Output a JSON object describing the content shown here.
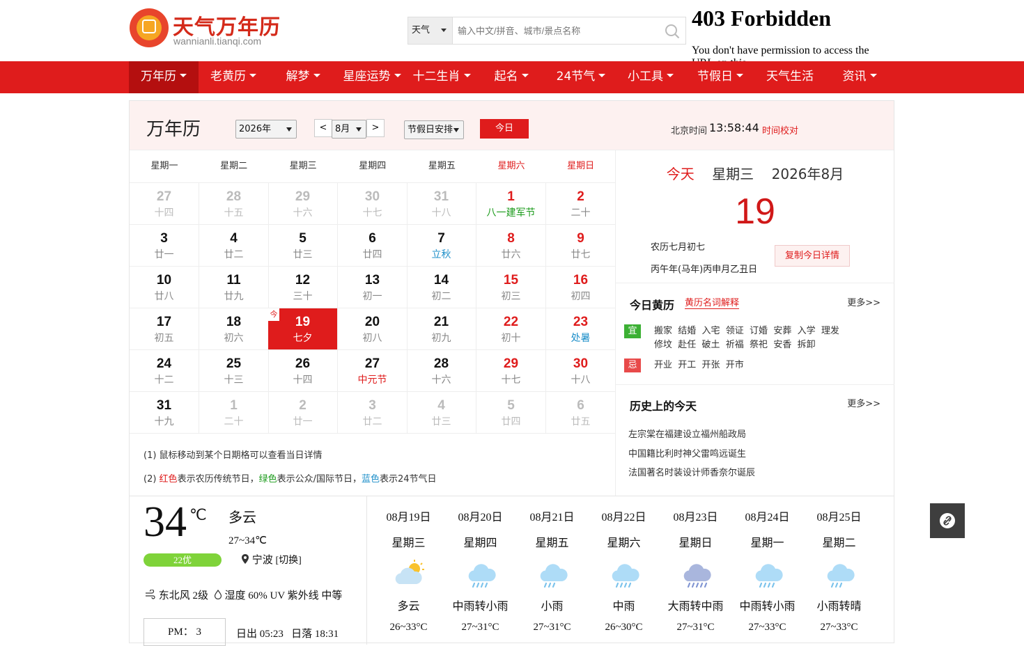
{
  "header": {
    "logo_title": "天气万年历",
    "logo_sub": "wannianli.tianqi.com",
    "search_type": "天气",
    "search_placeholder": "输入中文/拼音、城市/景点名称",
    "error_title": "403 Forbidden",
    "error_text": "You don't have permission to access the URL on this"
  },
  "nav": [
    {
      "label": "万年历",
      "caret": true
    },
    {
      "label": "老黄历",
      "caret": true
    },
    {
      "label": "解梦",
      "caret": true
    },
    {
      "label": "星座运势",
      "caret": true
    },
    {
      "label": "十二生肖",
      "caret": true
    },
    {
      "label": "起名",
      "caret": true
    },
    {
      "label": "24节气",
      "caret": true
    },
    {
      "label": "小工具",
      "caret": true
    },
    {
      "label": "节假日",
      "caret": true
    },
    {
      "label": "天气生活",
      "caret": false
    },
    {
      "label": "资讯",
      "caret": true
    }
  ],
  "calendar": {
    "title": "万年历",
    "year": "2026年",
    "prev": "<",
    "month": "8月",
    "next": ">",
    "holiday_select": "节假日安排",
    "today_btn": "今日",
    "beijing_label": "北京时间",
    "beijing_time": "13:58:44",
    "time_sync": "时间校对",
    "weekdays": [
      "星期一",
      "星期二",
      "星期三",
      "星期四",
      "星期五",
      "星期六",
      "星期日"
    ],
    "today_mark": "今",
    "weeks": [
      [
        {
          "d": "27",
          "l": "十四",
          "t": "other"
        },
        {
          "d": "28",
          "l": "十五",
          "t": "other"
        },
        {
          "d": "29",
          "l": "十六",
          "t": "other"
        },
        {
          "d": "30",
          "l": "十七",
          "t": "other"
        },
        {
          "d": "31",
          "l": "十八",
          "t": "other"
        },
        {
          "d": "1",
          "l": "八一建军节",
          "t": "red",
          "lc": "green"
        },
        {
          "d": "2",
          "l": "二十",
          "t": "red"
        }
      ],
      [
        {
          "d": "3",
          "l": "廿一"
        },
        {
          "d": "4",
          "l": "廿二"
        },
        {
          "d": "5",
          "l": "廿三"
        },
        {
          "d": "6",
          "l": "廿四"
        },
        {
          "d": "7",
          "l": "立秋",
          "lc": "blue"
        },
        {
          "d": "8",
          "l": "廿六",
          "t": "red"
        },
        {
          "d": "9",
          "l": "廿七",
          "t": "red"
        }
      ],
      [
        {
          "d": "10",
          "l": "廿八"
        },
        {
          "d": "11",
          "l": "廿九"
        },
        {
          "d": "12",
          "l": "三十"
        },
        {
          "d": "13",
          "l": "初一"
        },
        {
          "d": "14",
          "l": "初二"
        },
        {
          "d": "15",
          "l": "初三",
          "t": "red"
        },
        {
          "d": "16",
          "l": "初四",
          "t": "red"
        }
      ],
      [
        {
          "d": "17",
          "l": "初五"
        },
        {
          "d": "18",
          "l": "初六"
        },
        {
          "d": "19",
          "l": "七夕",
          "t": "today"
        },
        {
          "d": "20",
          "l": "初八"
        },
        {
          "d": "21",
          "l": "初九"
        },
        {
          "d": "22",
          "l": "初十",
          "t": "red"
        },
        {
          "d": "23",
          "l": "处暑",
          "t": "red",
          "lc": "blue"
        }
      ],
      [
        {
          "d": "24",
          "l": "十二"
        },
        {
          "d": "25",
          "l": "十三"
        },
        {
          "d": "26",
          "l": "十四"
        },
        {
          "d": "27",
          "l": "中元节",
          "lc": "redt"
        },
        {
          "d": "28",
          "l": "十六"
        },
        {
          "d": "29",
          "l": "十七",
          "t": "red"
        },
        {
          "d": "30",
          "l": "十八",
          "t": "red"
        }
      ],
      [
        {
          "d": "31",
          "l": "十九"
        },
        {
          "d": "1",
          "l": "二十",
          "t": "other"
        },
        {
          "d": "2",
          "l": "廿一",
          "t": "other"
        },
        {
          "d": "3",
          "l": "廿二",
          "t": "other"
        },
        {
          "d": "4",
          "l": "廿三",
          "t": "other"
        },
        {
          "d": "5",
          "l": "廿四",
          "t": "other"
        },
        {
          "d": "6",
          "l": "廿五",
          "t": "other"
        }
      ]
    ],
    "note1": "(1) 鼠标移动到某个日期格可以查看当日详情",
    "note2_a": "(2) ",
    "note2_red": "红色",
    "note2_b": "表示农历传统节日，",
    "note2_green": "绿色",
    "note2_c": "表示公众/国际节日，",
    "note2_blue": "蓝色",
    "note2_d": "表示24节气日"
  },
  "today_panel": {
    "today_word": "今天",
    "weekday": "星期三",
    "yearmonth": "2026年8月",
    "day": "19",
    "lunar": "农历七月初七",
    "ganzhi": "丙午年(马年)丙申月乙丑日",
    "copy_btn": "复制今日详情",
    "huangli_title": "今日黄历",
    "huangli_link": "黄历名词解释",
    "more": "更多>>",
    "yi_tag": "宜",
    "yi_line1": "搬家  结婚  入宅  领证  订婚  安葬  入学  理发",
    "yi_line2": "修坟  赴任  破土  祈福  祭祀  安香  拆卸",
    "ji_tag": "忌",
    "ji_line": "开业  开工  开张  开市",
    "history_title": "历史上的今天",
    "history_more": "更多>>",
    "history": [
      "左宗棠在福建设立福州船政局",
      "中国籍比利时神父雷鸣远诞生",
      "法国著名时装设计师香奈尔诞辰"
    ]
  },
  "weather": {
    "temp": "34",
    "unit": "℃",
    "cond": "多云",
    "range": "27~34℃",
    "aqi": "22优",
    "city": "宁波",
    "switch": "[切换]",
    "wind": "东北风 2级",
    "humidity": "湿度 60%",
    "uv": "UV 紫外线 中等",
    "pm_label": "PM： 3",
    "sunrise": "日出 05:23",
    "sunset": "日落 18:31",
    "forecast": [
      {
        "date": "08月19日",
        "wd": "星期三",
        "cond": "多云",
        "range": "26~33°C",
        "icon": "partly-cloudy-icon"
      },
      {
        "date": "08月20日",
        "wd": "星期四",
        "cond": "中雨转小雨",
        "range": "27~31°C",
        "icon": "rain-icon"
      },
      {
        "date": "08月21日",
        "wd": "星期五",
        "cond": "小雨",
        "range": "27~31°C",
        "icon": "light-rain-icon"
      },
      {
        "date": "08月22日",
        "wd": "星期六",
        "cond": "中雨",
        "range": "26~30°C",
        "icon": "rain-icon"
      },
      {
        "date": "08月23日",
        "wd": "星期日",
        "cond": "大雨转中雨",
        "range": "27~31°C",
        "icon": "heavy-rain-icon"
      },
      {
        "date": "08月24日",
        "wd": "星期一",
        "cond": "中雨转小雨",
        "range": "27~33°C",
        "icon": "rain-icon"
      },
      {
        "date": "08月25日",
        "wd": "星期二",
        "cond": "小雨转晴",
        "range": "27~33°C",
        "icon": "light-rain-icon"
      }
    ]
  },
  "colors": {
    "brand_red": "#df1c1c",
    "nav_active": "#b40f0f",
    "green": "#1b9b1b",
    "blue": "#1e8fc9"
  }
}
